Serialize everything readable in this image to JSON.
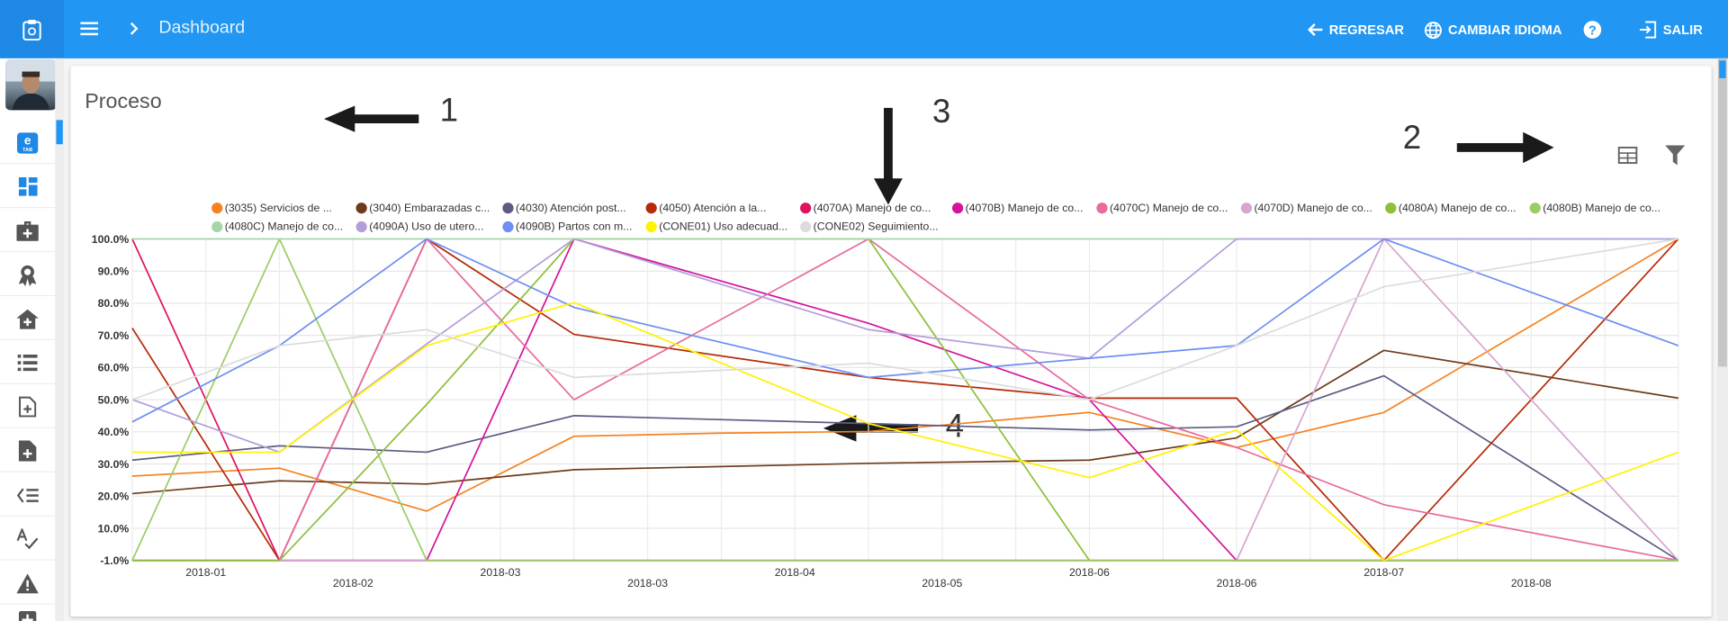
{
  "topbar": {
    "title": "Dashboard",
    "back_label": "REGRESAR",
    "language_label": "CAMBIAR IDIOMA",
    "exit_label": "SALIR",
    "color": "#2196f3"
  },
  "sidebar": {
    "items": [
      {
        "icon": "etab-icon"
      },
      {
        "icon": "dashboard-icon"
      },
      {
        "icon": "medical-kit-icon"
      },
      {
        "icon": "award-icon"
      },
      {
        "icon": "hospital-icon"
      },
      {
        "icon": "list-icon"
      },
      {
        "icon": "add-document-icon"
      },
      {
        "icon": "add-file-icon"
      },
      {
        "icon": "list-check-icon"
      },
      {
        "icon": "spellcheck-icon"
      },
      {
        "icon": "warning-icon"
      },
      {
        "icon": "medical-icon"
      }
    ]
  },
  "card": {
    "title": "Proceso",
    "annotations": [
      "1",
      "2",
      "3",
      "4"
    ]
  },
  "chart_data": {
    "type": "line",
    "title": "",
    "xlabel": "",
    "ylabel": "",
    "x_ticks": [
      "2018-01",
      "2018-02",
      "2018-03",
      "2018-03",
      "2018-04",
      "2018-05",
      "2018-06",
      "2018-06",
      "2018-07",
      "2018-08"
    ],
    "y_ticks": [
      "100.0%",
      "90.0%",
      "80.0%",
      "70.0%",
      "60.0%",
      "50.0%",
      "40.0%",
      "30.0%",
      "20.0%",
      "10.0%",
      "-1.0%"
    ],
    "ylim": [
      -1,
      100
    ],
    "grid": true,
    "legend_position": "top",
    "series": [
      {
        "name": "(3035) Servicios de ...",
        "color": "#f58220",
        "points": [
          [
            0,
            25.5
          ],
          [
            2,
            28
          ],
          [
            4,
            14.5
          ],
          [
            6,
            38
          ],
          [
            8,
            39
          ],
          [
            10,
            39.5
          ],
          [
            13,
            45.5
          ],
          [
            15,
            34.5
          ],
          [
            17,
            45.5
          ],
          [
            21,
            100
          ]
        ]
      },
      {
        "name": "(3040) Embarazadas c...",
        "color": "#6d3b1b",
        "points": [
          [
            0,
            20
          ],
          [
            2,
            24
          ],
          [
            4,
            23
          ],
          [
            6,
            27.5
          ],
          [
            10,
            29.5
          ],
          [
            13,
            30.5
          ],
          [
            15,
            37.5
          ],
          [
            17,
            65
          ],
          [
            21,
            50
          ]
        ]
      },
      {
        "name": "(4030) Atención post...",
        "color": "#5b5b84",
        "points": [
          [
            0,
            30.5
          ],
          [
            2,
            35
          ],
          [
            4,
            33
          ],
          [
            6,
            44.5
          ],
          [
            10,
            42
          ],
          [
            13,
            40
          ],
          [
            15,
            41
          ],
          [
            17,
            57
          ],
          [
            21,
            -1
          ]
        ]
      },
      {
        "name": "(4050) Atención a la...",
        "color": "#b52a08",
        "points": [
          [
            0,
            72
          ],
          [
            2,
            -1
          ],
          [
            4,
            100
          ],
          [
            6,
            70
          ],
          [
            10,
            56.5
          ],
          [
            13,
            50
          ],
          [
            15,
            50
          ],
          [
            17,
            -1
          ],
          [
            21,
            100
          ]
        ]
      },
      {
        "name": "(4070A) Manejo de co...",
        "color": "#e0115f",
        "points": [
          [
            0,
            100
          ],
          [
            2,
            -1
          ],
          [
            4,
            -1
          ],
          [
            6,
            -1
          ],
          [
            10,
            -1
          ],
          [
            13,
            -1
          ],
          [
            15,
            -1
          ],
          [
            17,
            -1
          ],
          [
            21,
            -1
          ]
        ]
      },
      {
        "name": "(4070B) Manejo de co...",
        "color": "#d4149c",
        "points": [
          [
            0,
            -1
          ],
          [
            2,
            -1
          ],
          [
            4,
            -1
          ],
          [
            6,
            100
          ],
          [
            10,
            73.5
          ],
          [
            13,
            49.5
          ],
          [
            15,
            -1
          ],
          [
            17,
            -1
          ],
          [
            21,
            -1
          ]
        ]
      },
      {
        "name": "(4070C) Manejo de co...",
        "color": "#e86a9e",
        "points": [
          [
            0,
            -1
          ],
          [
            2,
            -1
          ],
          [
            4,
            100
          ],
          [
            6,
            49.5
          ],
          [
            10,
            100
          ],
          [
            13,
            49.5
          ],
          [
            15,
            34.5
          ],
          [
            17,
            16.5
          ],
          [
            21,
            -1
          ]
        ]
      },
      {
        "name": "(4070D) Manejo de co...",
        "color": "#d5a6d0",
        "points": [
          [
            0,
            -1
          ],
          [
            2,
            -1
          ],
          [
            4,
            -1
          ],
          [
            6,
            -1
          ],
          [
            10,
            -1
          ],
          [
            13,
            -1
          ],
          [
            15,
            -1
          ],
          [
            17,
            100
          ],
          [
            21,
            -1
          ]
        ]
      },
      {
        "name": "(4080A) Manejo de co...",
        "color": "#8ebf3a",
        "points": [
          [
            0,
            -1
          ],
          [
            2,
            -1
          ],
          [
            4,
            48
          ],
          [
            6,
            100
          ],
          [
            10,
            100
          ],
          [
            13,
            -1
          ],
          [
            15,
            -1
          ],
          [
            17,
            -1
          ],
          [
            21,
            -1
          ]
        ]
      },
      {
        "name": "(4080B) Manejo de co...",
        "color": "#9ccc65",
        "points": [
          [
            0,
            -1
          ],
          [
            2,
            100
          ],
          [
            4,
            -1
          ],
          [
            6,
            -1
          ],
          [
            10,
            -1
          ],
          [
            13,
            -1
          ],
          [
            15,
            -1
          ],
          [
            17,
            -1
          ],
          [
            21,
            -1
          ]
        ]
      },
      {
        "name": "(4080C) Manejo de co...",
        "color": "#a5d6a7",
        "points": [
          [
            0,
            100
          ],
          [
            2,
            100
          ],
          [
            4,
            100
          ],
          [
            6,
            100
          ],
          [
            10,
            100
          ],
          [
            13,
            100
          ],
          [
            15,
            100
          ],
          [
            17,
            100
          ],
          [
            21,
            100
          ]
        ]
      },
      {
        "name": "(4090A) Uso de utero...",
        "color": "#b39ddb",
        "points": [
          [
            0,
            49.5
          ],
          [
            2,
            33
          ],
          [
            4,
            67
          ],
          [
            6,
            100
          ],
          [
            10,
            71.5
          ],
          [
            13,
            62.5
          ],
          [
            15,
            100
          ],
          [
            17,
            100
          ],
          [
            21,
            100
          ]
        ]
      },
      {
        "name": "(4090B) Partos con m...",
        "color": "#6d8ef2",
        "points": [
          [
            0,
            42.5
          ],
          [
            2,
            66.5
          ],
          [
            4,
            100
          ],
          [
            6,
            78.5
          ],
          [
            10,
            56.5
          ],
          [
            13,
            62.5
          ],
          [
            15,
            66.5
          ],
          [
            17,
            100
          ],
          [
            21,
            66.5
          ]
        ]
      },
      {
        "name": "(CONE01) Uso adecuad...",
        "color": "#fff200",
        "points": [
          [
            0,
            33
          ],
          [
            2,
            33
          ],
          [
            4,
            66.5
          ],
          [
            6,
            80
          ],
          [
            10,
            42
          ],
          [
            13,
            25
          ],
          [
            15,
            40
          ],
          [
            17,
            -1
          ],
          [
            21,
            33
          ]
        ]
      },
      {
        "name": "(CONE02) Seguimiento...",
        "color": "#dcdcdc",
        "points": [
          [
            0,
            49.5
          ],
          [
            2,
            66.5
          ],
          [
            4,
            71.5
          ],
          [
            6,
            56.5
          ],
          [
            10,
            61
          ],
          [
            13,
            49.5
          ],
          [
            15,
            66.5
          ],
          [
            17,
            85
          ],
          [
            21,
            100
          ]
        ]
      }
    ]
  }
}
